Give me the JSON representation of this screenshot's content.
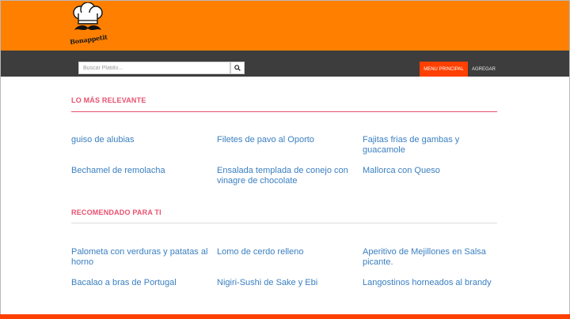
{
  "brand": {
    "logo_text": "Bonappetit"
  },
  "search": {
    "placeholder": "Buscar Platillo..."
  },
  "nav": {
    "active_label": "MENU PRINCIPAL",
    "add_label": "AGREGAR"
  },
  "sections": [
    {
      "title": "LO MÁS RELEVANTE",
      "items": [
        "guiso de alubias",
        "Filetes de pavo al Oporto",
        "Fajitas frias de gambas y guacamole",
        "Bechamel de remolacha",
        "Ensalada templada de conejo con vinagre de chocolate",
        "Mallorca con Queso"
      ]
    },
    {
      "title": "RECOMENDADO PARA TI",
      "items": [
        "Palometa con verduras y patatas al horno",
        "Lomo de cerdo relleno",
        "Aperitivo de Mejillones en Salsa picante.",
        "Bacalao a bras de Portugal",
        "Nigiri-Sushi de Sake y Ebi",
        "Langostinos horneados al brandy"
      ]
    }
  ],
  "colors": {
    "header": "#ff8000",
    "navbar": "#3d3d3d",
    "accent": "#ff4000",
    "section_title": "#e8516f",
    "link": "#3a7fc1"
  }
}
